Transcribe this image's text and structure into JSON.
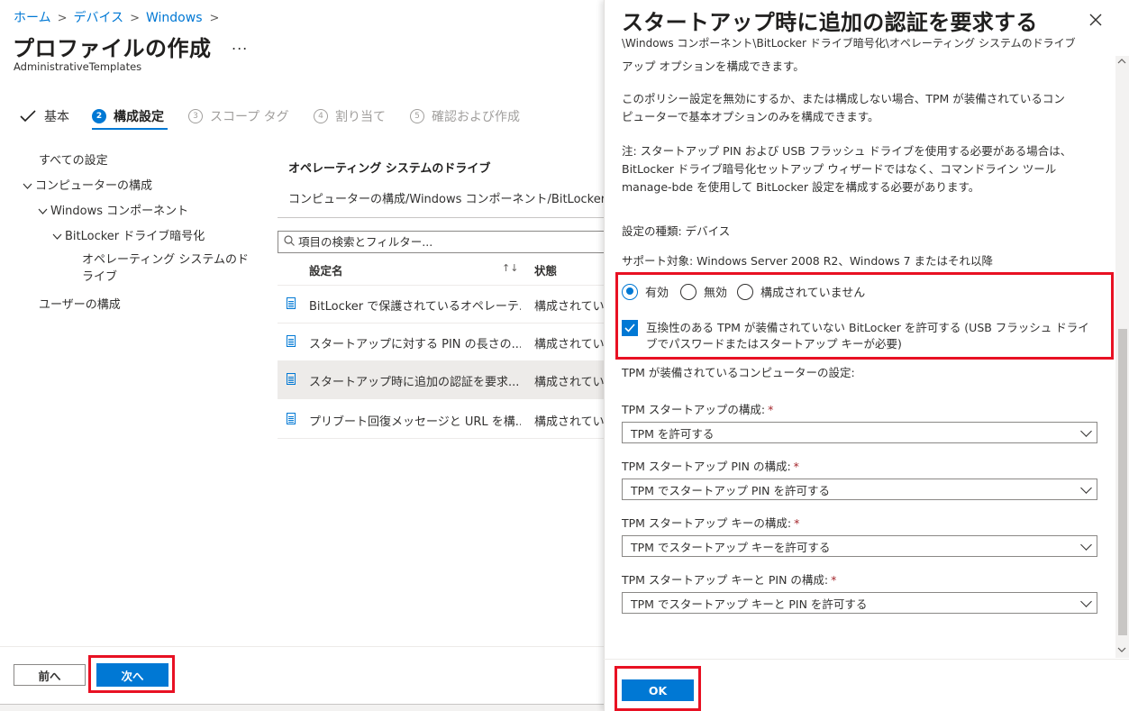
{
  "breadcrumb": {
    "items": [
      "ホーム",
      "デバイス",
      "Windows"
    ],
    "separator": ">"
  },
  "page": {
    "title": "プロファイルの作成",
    "more_label": "...",
    "subtitle": "AdministrativeTemplates"
  },
  "steps": [
    {
      "label": "基本",
      "state": "completed",
      "icon": "checkmark-icon"
    },
    {
      "label": "構成設定",
      "number": "2",
      "state": "active"
    },
    {
      "label": "スコープ タグ",
      "number": "3",
      "state": "disabled"
    },
    {
      "label": "割り当て",
      "number": "4",
      "state": "disabled"
    },
    {
      "label": "確認および作成",
      "number": "5",
      "state": "disabled"
    }
  ],
  "tree": {
    "all_settings": "すべての設定",
    "computer_config": "コンピューターの構成",
    "windows_components": "Windows コンポーネント",
    "bitlocker": "BitLocker ドライブ暗号化",
    "os_drives_line1": "オペレーティング システムのド",
    "os_drives_line2": "ライブ",
    "user_config": "ユーザーの構成"
  },
  "section": {
    "heading": "オペレーティング システムのドライブ",
    "path": "コンピューターの構成/Windows コンポーネント/BitLocker ドライブ暗号化",
    "search_placeholder": "項目の検索とフィルター..."
  },
  "table": {
    "columns": [
      "設定名",
      "状態"
    ],
    "sort_icon": "↑↓",
    "rows": [
      {
        "name": "BitLocker で保護されているオペレーテ...",
        "state": "構成されていません",
        "selected": false
      },
      {
        "name": "スタートアップに対する PIN の長さの...",
        "state": "構成されていません",
        "selected": false
      },
      {
        "name": "スタートアップ時に追加の認証を要求...",
        "state": "構成されていません",
        "selected": true
      },
      {
        "name": "プリブート回復メッセージと URL を構...",
        "state": "構成されていません",
        "selected": false
      }
    ]
  },
  "footer": {
    "prev_label": "前へ",
    "next_label": "次へ"
  },
  "panel": {
    "title": "スタートアップ時に追加の認証を要求する",
    "close_icon": "×",
    "path": "\\Windows コンポーネント\\BitLocker ドライブ暗号化\\オペレーティング システムのドライブ",
    "text_truncated": "アップ オプションを構成できます。",
    "text_disabled_1": "このポリシー設定を無効にするか、または構成しない場合、TPM が装備されているコン",
    "text_disabled_2": "ピューターで基本オプションのみを構成できます。",
    "note_1": "注: スタートアップ PIN および USB フラッシュ ドライブを使用する必要がある場合は、",
    "note_2": "BitLocker ドライブ暗号化セットアップ ウィザードではなく、コマンドライン ツール",
    "note_3": "manage-bde を使用して BitLocker 設定を構成する必要があります。",
    "setting_type": "設定の種類: デバイス",
    "supported_on": "サポート対象: Windows Server 2008 R2、Windows 7 またはそれ以降",
    "radios": [
      "有効",
      "無効",
      "構成されていません"
    ],
    "radio_selected": "有効",
    "checkbox_checked": true,
    "checkbox_line1": "互換性のある TPM が装備されていない BitLocker を許可する (USB フラッシュ ドライ",
    "checkbox_line2": "ブでパスワードまたはスタートアップ キーが必要)",
    "tpm_section": "TPM が装備されているコンピューターの設定:",
    "fields": [
      {
        "label": "TPM スタートアップの構成:",
        "required": "*",
        "value": "TPM を許可する"
      },
      {
        "label": "TPM スタートアップ PIN の構成:",
        "required": "*",
        "value": "TPM でスタートアップ PIN を許可する"
      },
      {
        "label": "TPM スタートアップ キーの構成:",
        "required": "*",
        "value": "TPM でスタートアップ キーを許可する"
      },
      {
        "label": "TPM スタートアップ キーと PIN の構成:",
        "required": "*",
        "value": "TPM でスタートアップ キーと PIN を許可する"
      }
    ],
    "ok_label": "OK"
  },
  "colors": {
    "accent": "#0078d4",
    "highlight": "#e81123",
    "required": "#a4262c"
  }
}
